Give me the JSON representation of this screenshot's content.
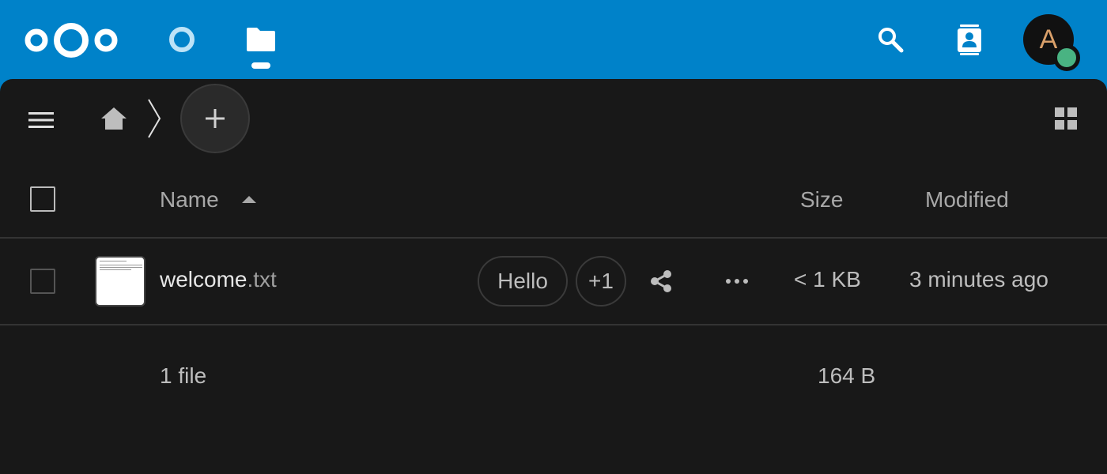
{
  "header": {
    "logo": "nextcloud-logo",
    "apps": [
      {
        "name": "Dashboard",
        "icon": "dashboard-icon"
      },
      {
        "name": "Files",
        "icon": "folder-icon",
        "active": true
      }
    ],
    "search_icon": "search-icon",
    "contacts_icon": "contacts-icon",
    "avatar_initial": "A",
    "status_color": "#49b382",
    "brand_color": "#0082c9"
  },
  "toolbar": {
    "menu_icon": "hamburger-icon",
    "home_icon": "home-icon",
    "new_icon": "plus-icon",
    "view_toggle_icon": "grid-view-icon"
  },
  "table": {
    "columns": {
      "name": "Name",
      "size": "Size",
      "modified": "Modified"
    },
    "sort": {
      "column": "Name",
      "direction": "ascending"
    },
    "rows": [
      {
        "basename": "welcome",
        "extension": ".txt",
        "tags": [
          "Hello"
        ],
        "more_tags": "+1",
        "size": "< 1 KB",
        "modified": "3 minutes ago"
      }
    ]
  },
  "summary": {
    "count": "1 file",
    "size": "164 B"
  }
}
